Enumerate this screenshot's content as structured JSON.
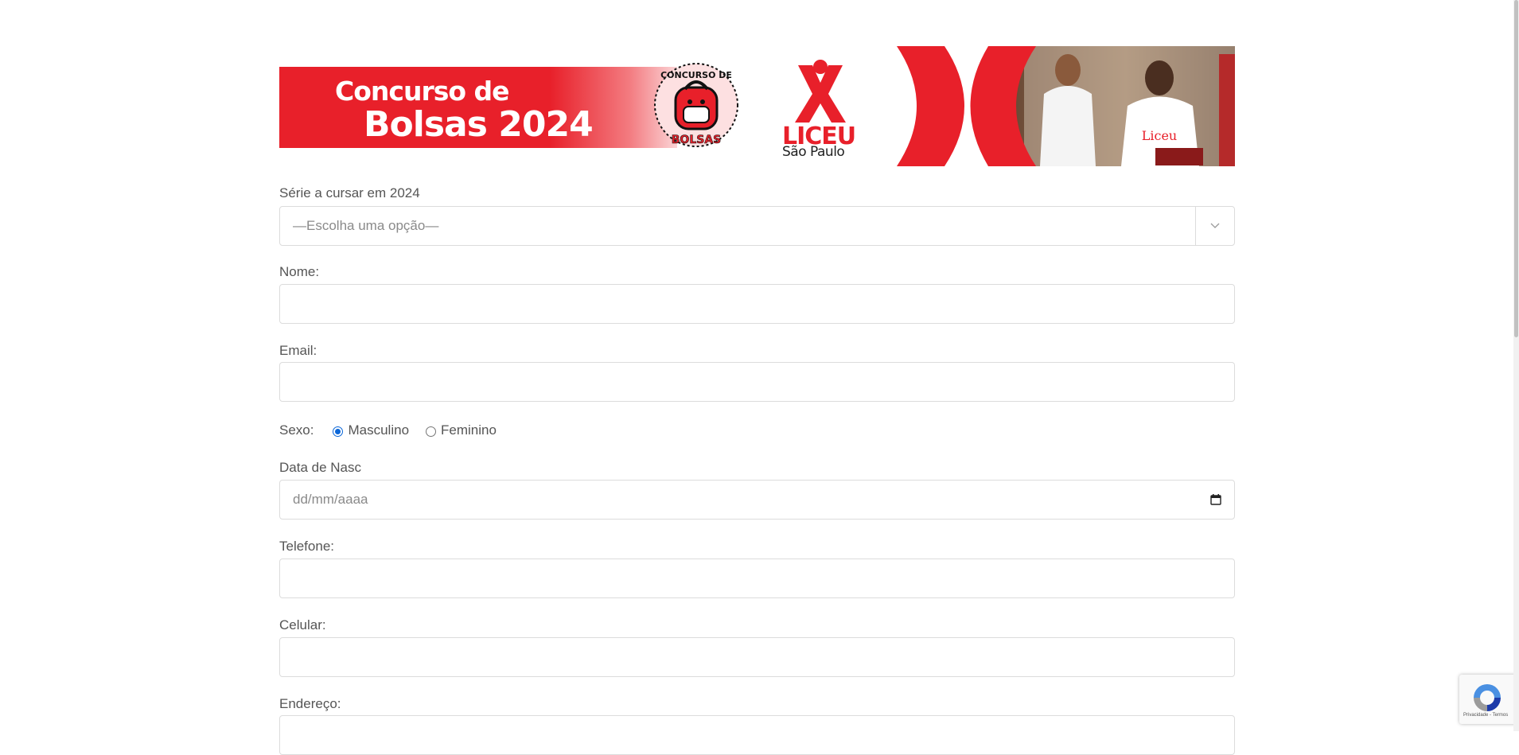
{
  "banner": {
    "title_line1": "Concurso de",
    "title_line2": "Bolsas 2024",
    "seal_top": "CONCURSO DE",
    "seal_bottom": "BOLSAS",
    "logo_name": "LICEU",
    "logo_city": "São Paulo",
    "photo_shirt_text": "Liceu",
    "colors": {
      "brand_red": "#e8202a"
    }
  },
  "form": {
    "serie": {
      "label": "Série a cursar em 2024",
      "selected": "—Escolha uma opção—"
    },
    "nome": {
      "label": "Nome:",
      "value": ""
    },
    "email": {
      "label": "Email:",
      "value": ""
    },
    "sexo": {
      "label": "Sexo:",
      "options": [
        {
          "label": "Masculino",
          "checked": true
        },
        {
          "label": "Feminino",
          "checked": false
        }
      ]
    },
    "data_nasc": {
      "label": "Data de Nasc",
      "placeholder": "dd/mm/aaaa"
    },
    "telefone": {
      "label": "Telefone:",
      "value": ""
    },
    "celular": {
      "label": "Celular:",
      "value": ""
    },
    "endereco": {
      "label": "Endereço:",
      "value": ""
    }
  },
  "recaptcha": {
    "footer": "Privacidade - Termos",
    "icon": "recaptcha-icon"
  }
}
